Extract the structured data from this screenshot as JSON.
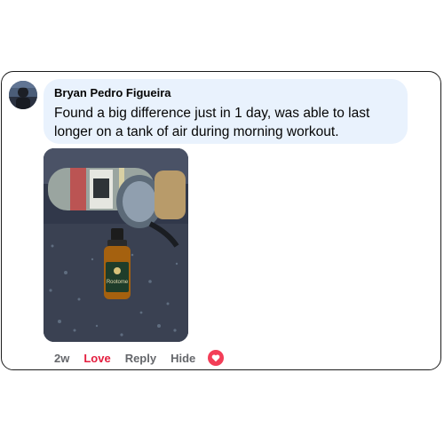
{
  "comment": {
    "author": "Bryan Pedro Figueira",
    "text": "Found a big difference just in 1 day, was able to last longer on a tank of air during morning workout.",
    "photo": {
      "bottle_label": "Rootome"
    },
    "actions": {
      "time": "2w",
      "love": "Love",
      "reply": "Reply",
      "hide": "Hide"
    },
    "reaction_icon": "heart-reaction-icon"
  },
  "colors": {
    "bubble_background": "#e9f2fd",
    "love_active": "#e41e3f",
    "action_gray": "#65676b",
    "card_border": "#1c1c1c"
  }
}
